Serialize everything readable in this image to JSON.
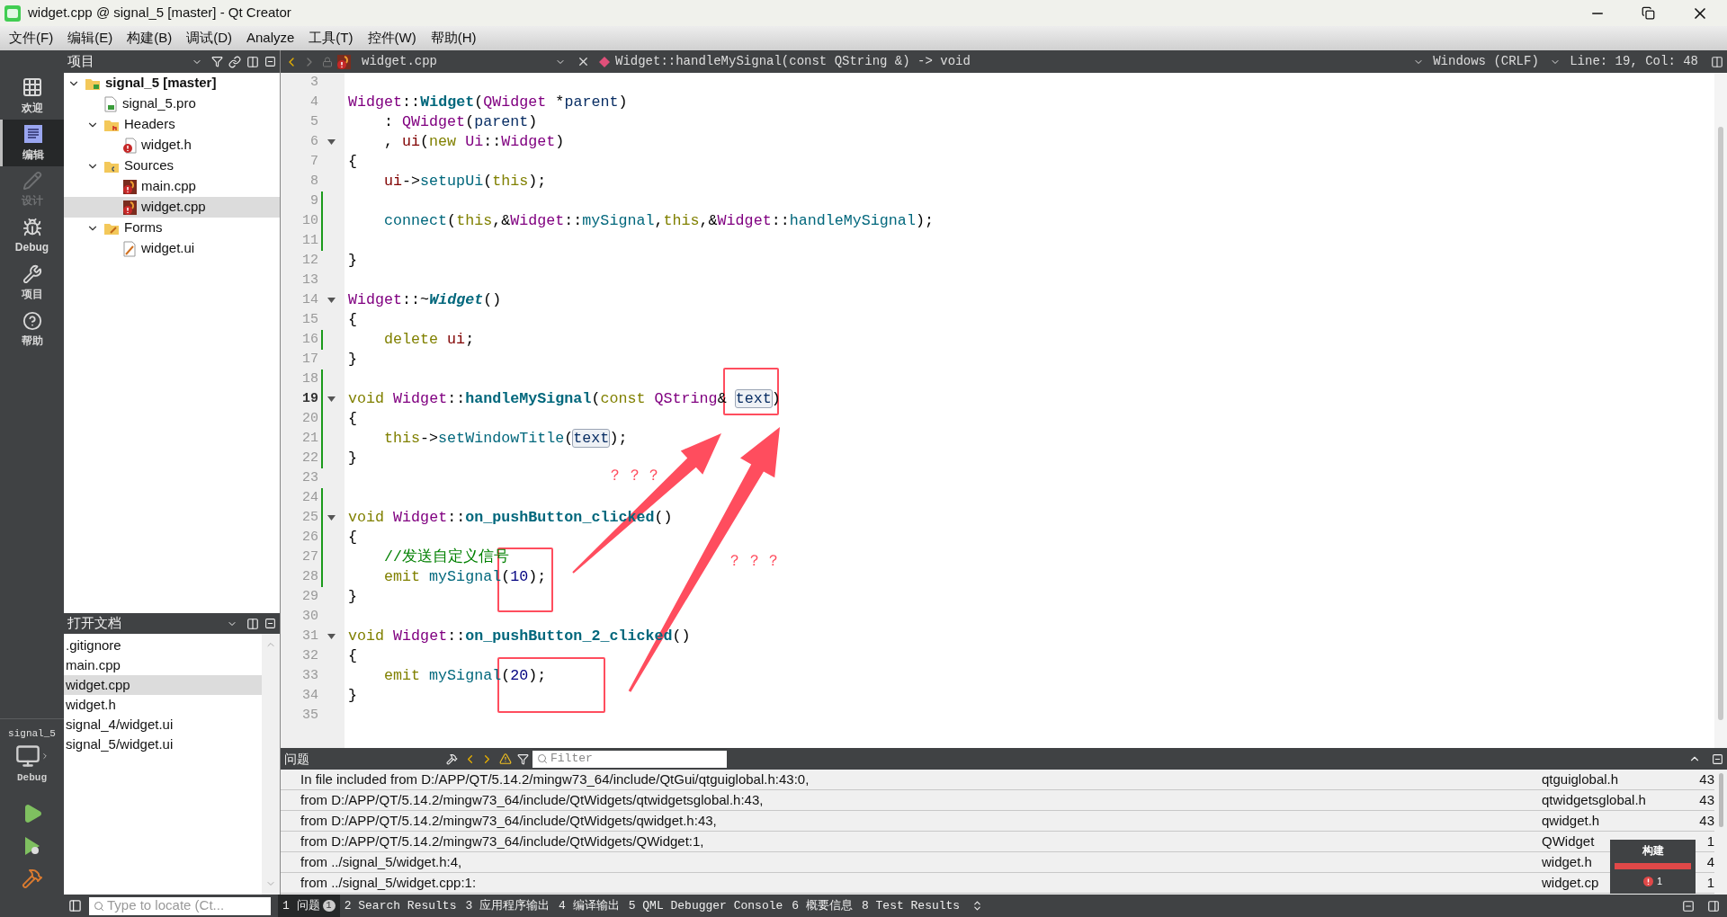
{
  "window": {
    "title": "widget.cpp @ signal_5 [master] - Qt Creator"
  },
  "menu": [
    "文件(F)",
    "编辑(E)",
    "构建(B)",
    "调试(D)",
    "Analyze",
    "工具(T)",
    "控件(W)",
    "帮助(H)"
  ],
  "modes": [
    {
      "label": "欢迎",
      "kind": "welcome",
      "selected": false,
      "disabled": false
    },
    {
      "label": "编辑",
      "kind": "edit",
      "selected": true,
      "disabled": false
    },
    {
      "label": "设计",
      "kind": "design",
      "selected": false,
      "disabled": true
    },
    {
      "label": "Debug",
      "kind": "debug",
      "selected": false,
      "disabled": false
    },
    {
      "label": "项目",
      "kind": "projects",
      "selected": false,
      "disabled": false
    },
    {
      "label": "帮助",
      "kind": "help",
      "selected": false,
      "disabled": false
    }
  ],
  "kit": {
    "project": "signal_5",
    "config": "Debug"
  },
  "project_panel": {
    "title": "项目",
    "tree": [
      {
        "label": "signal_5 [master]",
        "kind": "project",
        "expanded": true,
        "selected": false,
        "children": [
          {
            "label": "signal_5.pro",
            "kind": "pro",
            "selected": false
          },
          {
            "label": "Headers",
            "kind": "headers",
            "expanded": true,
            "selected": false,
            "children": [
              {
                "label": "widget.h",
                "kind": "header",
                "selected": false
              }
            ]
          },
          {
            "label": "Sources",
            "kind": "sources",
            "expanded": true,
            "selected": false,
            "children": [
              {
                "label": "main.cpp",
                "kind": "source",
                "selected": false
              },
              {
                "label": "widget.cpp",
                "kind": "source",
                "selected": true
              }
            ]
          },
          {
            "label": "Forms",
            "kind": "forms",
            "expanded": true,
            "selected": false,
            "children": [
              {
                "label": "widget.ui",
                "kind": "form",
                "selected": false
              }
            ]
          }
        ]
      }
    ]
  },
  "open_documents": {
    "title": "打开文档",
    "items": [
      {
        "label": ".gitignore",
        "selected": false
      },
      {
        "label": "main.cpp",
        "selected": false
      },
      {
        "label": "widget.cpp",
        "selected": true
      },
      {
        "label": "widget.h",
        "selected": false
      },
      {
        "label": "signal_4/widget.ui",
        "selected": false
      },
      {
        "label": "signal_5/widget.ui",
        "selected": false
      }
    ]
  },
  "editor": {
    "file": "widget.cpp",
    "symbol": "Widget::handleMySignal(const QString &) -> void",
    "line_ending": "Windows (CRLF)",
    "position": "Line: 19, Col: 48",
    "lines": [
      {
        "number": "3",
        "current": false,
        "changed": false,
        "fold": false
      },
      {
        "number": "4",
        "current": false,
        "changed": false,
        "fold": false,
        "indented": false,
        "tokens": [
          {
            "text": "Widget",
            "kind": "type"
          },
          {
            "text": "::",
            "kind": "plain"
          },
          {
            "text": "Widget",
            "kind": "funcdef"
          },
          {
            "text": "(",
            "kind": "plain"
          },
          {
            "text": "QWidget",
            "kind": "type"
          },
          {
            "text": " *",
            "kind": "plain"
          },
          {
            "text": "parent",
            "kind": "param"
          },
          {
            "text": ")",
            "kind": "plain"
          }
        ]
      },
      {
        "number": "5",
        "current": false,
        "changed": false,
        "fold": false,
        "indented": true,
        "tokens": [
          {
            "text": ": ",
            "kind": "plain"
          },
          {
            "text": "QWidget",
            "kind": "type"
          },
          {
            "text": "(",
            "kind": "plain"
          },
          {
            "text": "parent",
            "kind": "param"
          },
          {
            "text": ")",
            "kind": "plain"
          }
        ]
      },
      {
        "number": "6",
        "current": false,
        "changed": false,
        "fold": true,
        "indented": true,
        "tokens": [
          {
            "text": ", ",
            "kind": "plain"
          },
          {
            "text": "ui",
            "kind": "member"
          },
          {
            "text": "(",
            "kind": "plain"
          },
          {
            "text": "new ",
            "kind": "kw"
          },
          {
            "text": "Ui",
            "kind": "type"
          },
          {
            "text": "::",
            "kind": "plain"
          },
          {
            "text": "Widget",
            "kind": "type"
          },
          {
            "text": ")",
            "kind": "plain"
          }
        ]
      },
      {
        "number": "7",
        "current": false,
        "changed": false,
        "fold": false,
        "indented": false,
        "tokens": [
          {
            "text": "{",
            "kind": "plain"
          }
        ]
      },
      {
        "number": "8",
        "current": false,
        "changed": false,
        "fold": false,
        "indented": true,
        "tokens": [
          {
            "text": "ui",
            "kind": "member"
          },
          {
            "text": "->",
            "kind": "plain"
          },
          {
            "text": "setupUi",
            "kind": "call"
          },
          {
            "text": "(",
            "kind": "plain"
          },
          {
            "text": "this",
            "kind": "kw"
          },
          {
            "text": ");",
            "kind": "plain"
          }
        ]
      },
      {
        "number": "9",
        "current": false,
        "changed": true,
        "fold": false
      },
      {
        "number": "10",
        "current": false,
        "changed": true,
        "fold": false,
        "indented": true,
        "tokens": [
          {
            "text": "connect",
            "kind": "call"
          },
          {
            "text": "(",
            "kind": "plain"
          },
          {
            "text": "this",
            "kind": "kw"
          },
          {
            "text": ",&",
            "kind": "plain"
          },
          {
            "text": "Widget",
            "kind": "type"
          },
          {
            "text": "::",
            "kind": "plain"
          },
          {
            "text": "mySignal",
            "kind": "call"
          },
          {
            "text": ",",
            "kind": "plain"
          },
          {
            "text": "this",
            "kind": "kw"
          },
          {
            "text": ",&",
            "kind": "plain"
          },
          {
            "text": "Widget",
            "kind": "type"
          },
          {
            "text": "::",
            "kind": "plain"
          },
          {
            "text": "handleMySignal",
            "kind": "call"
          },
          {
            "text": ");",
            "kind": "plain"
          }
        ]
      },
      {
        "number": "11",
        "current": false,
        "changed": true,
        "fold": false
      },
      {
        "number": "12",
        "current": false,
        "changed": false,
        "fold": false,
        "indented": false,
        "tokens": [
          {
            "text": "}",
            "kind": "plain"
          }
        ]
      },
      {
        "number": "13",
        "current": false,
        "changed": false,
        "fold": false
      },
      {
        "number": "14",
        "current": false,
        "changed": false,
        "fold": true,
        "indented": false,
        "tokens": [
          {
            "text": "Widget",
            "kind": "type"
          },
          {
            "text": "::~",
            "kind": "plain"
          },
          {
            "text": "Widget",
            "kind": "dtor"
          },
          {
            "text": "()",
            "kind": "plain"
          }
        ]
      },
      {
        "number": "15",
        "current": false,
        "changed": false,
        "fold": false,
        "indented": false,
        "tokens": [
          {
            "text": "{",
            "kind": "plain"
          }
        ]
      },
      {
        "number": "16",
        "current": false,
        "changed": true,
        "fold": false,
        "indented": true,
        "tokens": [
          {
            "text": "delete ",
            "kind": "kw"
          },
          {
            "text": "ui",
            "kind": "member"
          },
          {
            "text": ";",
            "kind": "plain"
          }
        ]
      },
      {
        "number": "17",
        "current": false,
        "changed": false,
        "fold": false,
        "indented": false,
        "tokens": [
          {
            "text": "}",
            "kind": "plain"
          }
        ]
      },
      {
        "number": "18",
        "current": false,
        "changed": true,
        "fold": false
      },
      {
        "number": "19",
        "current": true,
        "changed": true,
        "fold": true,
        "indented": false,
        "tokens": [
          {
            "text": "void ",
            "kind": "kw"
          },
          {
            "text": "Widget",
            "kind": "type"
          },
          {
            "text": "::",
            "kind": "plain"
          },
          {
            "text": "handleMySignal",
            "kind": "funcdef"
          },
          {
            "text": "(",
            "kind": "plain"
          },
          {
            "text": "const ",
            "kind": "kw"
          },
          {
            "text": "QString",
            "kind": "type"
          },
          {
            "text": "& ",
            "kind": "plain"
          },
          {
            "text": "text",
            "kind": "hl"
          },
          {
            "text": ")",
            "kind": "plain"
          }
        ]
      },
      {
        "number": "20",
        "current": false,
        "changed": true,
        "fold": false,
        "indented": false,
        "tokens": [
          {
            "text": "{",
            "kind": "plain"
          }
        ]
      },
      {
        "number": "21",
        "current": false,
        "changed": true,
        "fold": false,
        "indented": true,
        "tokens": [
          {
            "text": "this",
            "kind": "kw"
          },
          {
            "text": "->",
            "kind": "plain"
          },
          {
            "text": "setWindowTitle",
            "kind": "call"
          },
          {
            "text": "(",
            "kind": "plain"
          },
          {
            "text": "text",
            "kind": "hl"
          },
          {
            "text": ");",
            "kind": "plain"
          }
        ]
      },
      {
        "number": "22",
        "current": false,
        "changed": true,
        "fold": false,
        "indented": false,
        "tokens": [
          {
            "text": "}",
            "kind": "plain"
          }
        ]
      },
      {
        "number": "23",
        "current": false,
        "changed": false,
        "fold": false
      },
      {
        "number": "24",
        "current": false,
        "changed": true,
        "fold": false
      },
      {
        "number": "25",
        "current": false,
        "changed": true,
        "fold": true,
        "indented": false,
        "tokens": [
          {
            "text": "void ",
            "kind": "kw"
          },
          {
            "text": "Widget",
            "kind": "type"
          },
          {
            "text": "::",
            "kind": "plain"
          },
          {
            "text": "on_pushButton_clicked",
            "kind": "funcdef"
          },
          {
            "text": "()",
            "kind": "plain"
          }
        ]
      },
      {
        "number": "26",
        "current": false,
        "changed": true,
        "fold": false,
        "indented": false,
        "tokens": [
          {
            "text": "{",
            "kind": "plain"
          }
        ]
      },
      {
        "number": "27",
        "current": false,
        "changed": true,
        "fold": false,
        "indented": true,
        "tokens": [
          {
            "text": "//发送自定义信号",
            "kind": "comment"
          }
        ]
      },
      {
        "number": "28",
        "current": false,
        "changed": true,
        "fold": false,
        "indented": true,
        "tokens": [
          {
            "text": "emit ",
            "kind": "kw"
          },
          {
            "text": "mySignal",
            "kind": "call"
          },
          {
            "text": "(",
            "kind": "plain"
          },
          {
            "text": "10",
            "kind": "num"
          },
          {
            "text": ");",
            "kind": "plain"
          }
        ]
      },
      {
        "number": "29",
        "current": false,
        "changed": false,
        "fold": false,
        "indented": false,
        "tokens": [
          {
            "text": "}",
            "kind": "plain"
          }
        ]
      },
      {
        "number": "30",
        "current": false,
        "changed": false,
        "fold": false
      },
      {
        "number": "31",
        "current": false,
        "changed": false,
        "fold": true,
        "indented": false,
        "tokens": [
          {
            "text": "void ",
            "kind": "kw"
          },
          {
            "text": "Widget",
            "kind": "type"
          },
          {
            "text": "::",
            "kind": "plain"
          },
          {
            "text": "on_pushButton_2_clicked",
            "kind": "funcdef"
          },
          {
            "text": "()",
            "kind": "plain"
          }
        ]
      },
      {
        "number": "32",
        "current": false,
        "changed": false,
        "fold": false,
        "indented": false,
        "tokens": [
          {
            "text": "{",
            "kind": "plain"
          }
        ]
      },
      {
        "number": "33",
        "current": false,
        "changed": false,
        "fold": false,
        "indented": true,
        "tokens": [
          {
            "text": "emit ",
            "kind": "kw"
          },
          {
            "text": "mySignal",
            "kind": "call"
          },
          {
            "text": "(",
            "kind": "plain"
          },
          {
            "text": "20",
            "kind": "num"
          },
          {
            "text": ");",
            "kind": "plain"
          }
        ]
      },
      {
        "number": "34",
        "current": false,
        "changed": false,
        "fold": false,
        "indented": false,
        "tokens": [
          {
            "text": "}",
            "kind": "plain"
          }
        ]
      },
      {
        "number": "35",
        "current": false,
        "changed": false,
        "fold": false
      }
    ]
  },
  "annotations": [
    {
      "text": "？ ？ ？"
    },
    {
      "text": "？ ？ ？"
    }
  ],
  "issues": {
    "title": "问题",
    "filter_placeholder": "Filter",
    "rows": [
      {
        "message": "In file included from D:/APP/QT/5.14.2/mingw73_64/include/QtGui/qtguiglobal.h:43:0,",
        "file": "qtguiglobal.h",
        "line": "43"
      },
      {
        "message": "from D:/APP/QT/5.14.2/mingw73_64/include/QtWidgets/qtwidgetsglobal.h:43,",
        "file": "qtwidgetsglobal.h",
        "line": "43"
      },
      {
        "message": "from D:/APP/QT/5.14.2/mingw73_64/include/QtWidgets/qwidget.h:43,",
        "file": "qwidget.h",
        "line": "43"
      },
      {
        "message": "from D:/APP/QT/5.14.2/mingw73_64/include/QtWidgets/QWidget:1,",
        "file": "QWidget",
        "line": "1"
      },
      {
        "message": "from ../signal_5/widget.h:4,",
        "file": "widget.h",
        "line": "4"
      },
      {
        "message": "from ../signal_5/widget.cpp:1:",
        "file": "widget.cp",
        "line": "1"
      }
    ]
  },
  "build_popup": {
    "title": "构建",
    "level": 1,
    "errors": "1"
  },
  "status_bar": {
    "locate_placeholder": "Type to locate (Ct...",
    "tabs": [
      {
        "label": "1 问题",
        "badge": "1",
        "selected": true
      },
      {
        "label": "2 Search Results",
        "selected": false
      },
      {
        "label": "3 应用程序输出",
        "selected": false
      },
      {
        "label": "4 编译输出",
        "selected": false
      },
      {
        "label": "5 QML Debugger Console",
        "selected": false
      },
      {
        "label": "6 概要信息",
        "selected": false
      },
      {
        "label": "8 Test Results",
        "selected": false
      }
    ]
  }
}
